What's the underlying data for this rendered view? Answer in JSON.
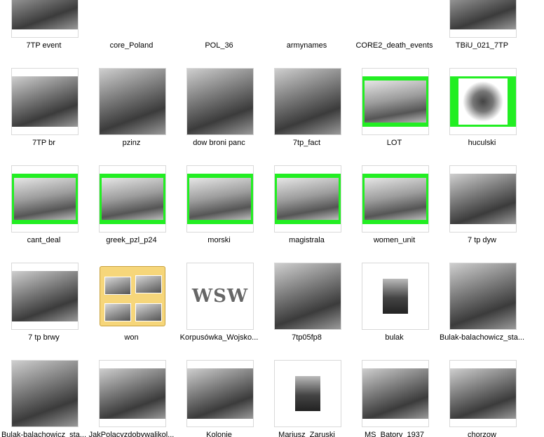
{
  "window": {
    "view": "thumbnails"
  },
  "items": [
    {
      "label": "7TP event",
      "kind": "photo"
    },
    {
      "label": "core_Poland",
      "kind": "doc"
    },
    {
      "label": "POL_36",
      "kind": "doc"
    },
    {
      "label": "armynames",
      "kind": "doc"
    },
    {
      "label": "CORE2_death_events",
      "kind": "doc"
    },
    {
      "label": "TBiU_021_7TP",
      "kind": "photo"
    },
    {
      "label": "7TP br",
      "kind": "photo"
    },
    {
      "label": "pzinz",
      "kind": "photo-tall"
    },
    {
      "label": "dow broni panc",
      "kind": "photo-tall"
    },
    {
      "label": "7tp_fact",
      "kind": "photo-tall"
    },
    {
      "label": "LOT",
      "kind": "green"
    },
    {
      "label": "huculski",
      "kind": "green-emblem"
    },
    {
      "label": "cant_deal",
      "kind": "green"
    },
    {
      "label": "greek_pzl_p24",
      "kind": "green"
    },
    {
      "label": "morski",
      "kind": "green"
    },
    {
      "label": "magistrala",
      "kind": "green"
    },
    {
      "label": "women_unit",
      "kind": "green"
    },
    {
      "label": "7 tp dyw",
      "kind": "photo"
    },
    {
      "label": "7 tp brwy",
      "kind": "photo"
    },
    {
      "label": "won",
      "kind": "folder"
    },
    {
      "label": "Korpusówka_Wojsko...",
      "kind": "emblem",
      "emblem_text": "WSW"
    },
    {
      "label": "7tp05fp8",
      "kind": "photo-tall"
    },
    {
      "label": "bulak",
      "kind": "photo-small"
    },
    {
      "label": "Bulak-balachowicz_sta...",
      "kind": "photo-tall"
    },
    {
      "label": "Bulak-balachowicz_sta...",
      "kind": "photo-tall"
    },
    {
      "label": "JakPolacyzdobywalikol...",
      "kind": "photo"
    },
    {
      "label": "Kolonie",
      "kind": "photo"
    },
    {
      "label": "Mariusz_Zaruski",
      "kind": "photo-small"
    },
    {
      "label": "MS_Batory_1937",
      "kind": "photo"
    },
    {
      "label": "chorzow",
      "kind": "photo"
    }
  ]
}
